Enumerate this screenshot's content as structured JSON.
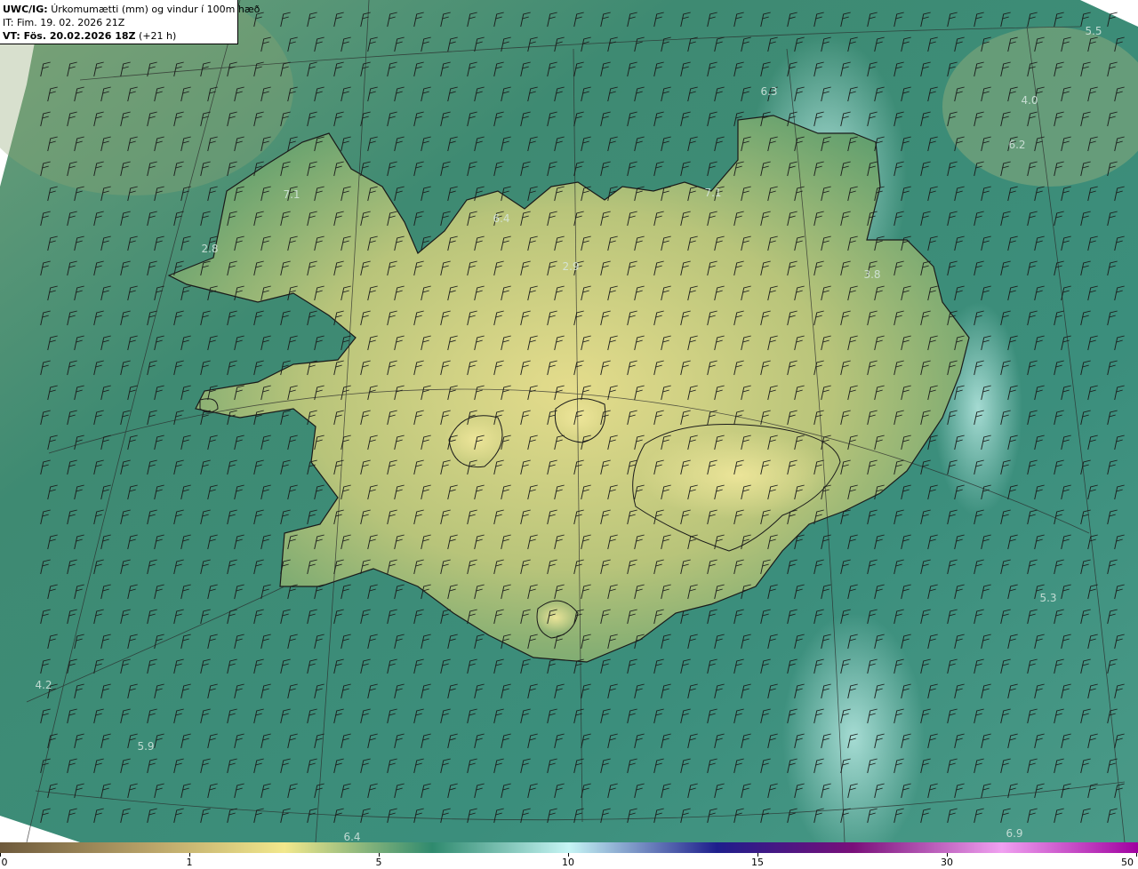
{
  "header": {
    "product": "UWC/IG:",
    "description": "Úrkomumætti (mm) og vindur í 100m hæð",
    "init_time": "IT: Fim. 19. 02. 2026 21Z",
    "valid_prefix": "VT: Fös. 20.02.2026 18Z",
    "valid_offset": " (+21 h)"
  },
  "value_labels": [
    "5.5",
    "6.3",
    "4.0",
    "6.2",
    "7.1",
    "7.1",
    "6.4",
    "2.8",
    "2.9",
    "3.8",
    "5.3",
    "4.2",
    "5.9",
    "6.4",
    "6.9"
  ],
  "colorbar": {
    "ticks": [
      "0",
      "1",
      "5",
      "10",
      "15",
      "30",
      "50"
    ],
    "colors": [
      "#6e5a3c",
      "#b8a268",
      "#f2e88c",
      "#2f8a6e",
      "#c6f5f5",
      "#1e1e8c",
      "#7a0f7a",
      "#f0a0f0",
      "#a000a0"
    ]
  }
}
